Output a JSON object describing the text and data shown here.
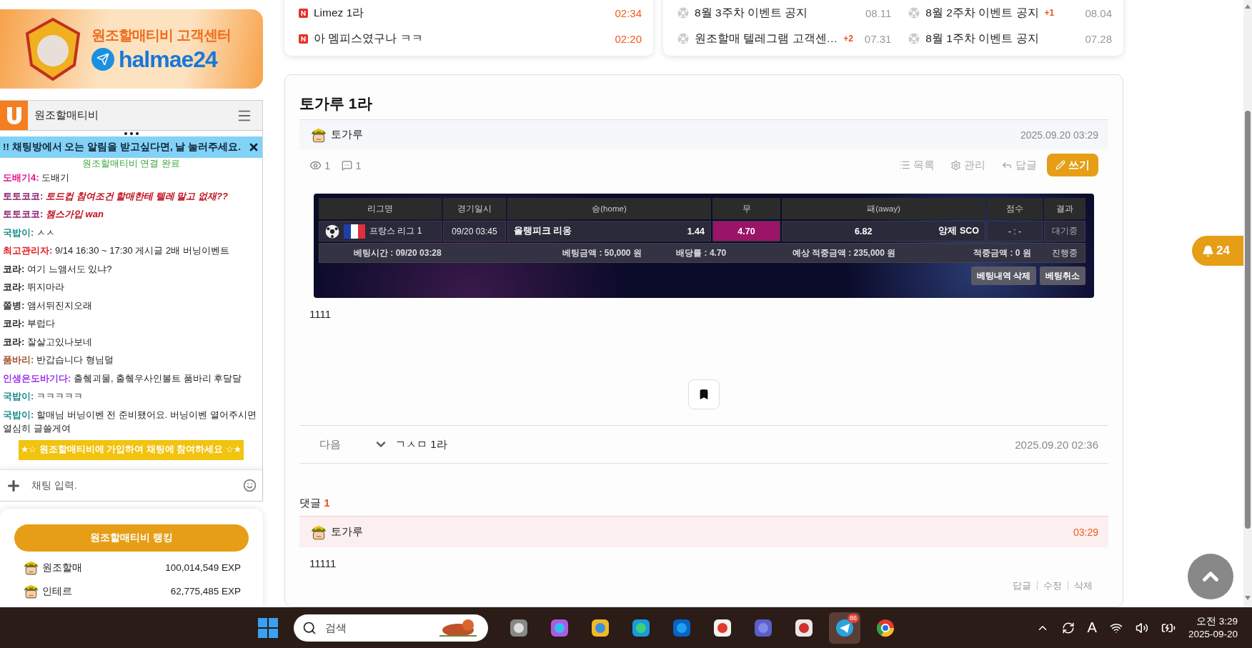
{
  "banner": {
    "title": "원조할매티비 고객센터",
    "handle": "halmae24"
  },
  "chat": {
    "title": "원조할매티비",
    "notice": "!! 채팅방에서 오는 알림을 받고싶다면, 날 눌러주세요.",
    "status": "원조할매티비 연결 완료",
    "messages": [
      {
        "user": "도배기4:",
        "color": "#e3128c",
        "text": "도배기",
        "emphasis": false
      },
      {
        "user": "토토코코:",
        "color": "#8a1d6e",
        "text": "토드컵 참여조건 할매한테 텔레 말고 없재??",
        "emphasis": true
      },
      {
        "user": "토토코코:",
        "color": "#8a1d6e",
        "text": "챔스가입 wan",
        "emphasis": true
      },
      {
        "user": "국밥이:",
        "color": "#178a8a",
        "text": "ㅅㅅ",
        "emphasis": false
      },
      {
        "user": "최고관리자:",
        "color": "#e01b1b",
        "text": "9/14 16:30 ~ 17:30 게시글 2배 버닝이벤트",
        "emphasis": false
      },
      {
        "user": "코라:",
        "color": "#222222",
        "text": "여기 느앰서도 있냐?",
        "emphasis": false
      },
      {
        "user": "코라:",
        "color": "#222222",
        "text": "뛰지마라",
        "emphasis": false
      },
      {
        "user": "쫄병:",
        "color": "#3a3a3a",
        "text": "앰서뒤진지오래",
        "emphasis": false
      },
      {
        "user": "코라:",
        "color": "#222222",
        "text": "부럽다",
        "emphasis": false
      },
      {
        "user": "코라:",
        "color": "#222222",
        "text": "잘살고있나보네",
        "emphasis": false
      },
      {
        "user": "품바리:",
        "color": "#a0522d",
        "text": "반갑습니다 형님덜",
        "emphasis": false
      },
      {
        "user": "인생은도바기다:",
        "color": "#9b2ff0",
        "text": "출췤괴물, 출췤우사인볼트 품바리 후달달",
        "emphasis": false
      },
      {
        "user": "국밥이:",
        "color": "#178a8a",
        "text": "ㅋㅋㅋㅋㅋ",
        "emphasis": false
      },
      {
        "user": "국밥이:",
        "color": "#178a8a",
        "text": "할매님 버닝이벤 전 준비됐어요. 버닝이벤 열어주시면 열심히 글쓸게여",
        "emphasis": false
      }
    ],
    "join_banner": "★☆ 원조할매티비에 가입하여 채팅에 참여하세요 ☆★",
    "input": {
      "placeholder": "채팅 입력."
    }
  },
  "ranking": {
    "button": "원조할매티비 랭킹",
    "rows": [
      {
        "name": "원조할매",
        "exp": "100,014,549 EXP"
      },
      {
        "name": "인테르",
        "exp": "62,775,485 EXP"
      }
    ]
  },
  "news": [
    {
      "title": "Limez 1라",
      "time": "02:34"
    },
    {
      "title": "아 멤피스였구나 ㅋㅋ",
      "time": "02:20"
    }
  ],
  "notices": [
    [
      {
        "title": "8월 3주차 이벤트 공지",
        "date": "08.11"
      },
      {
        "title": "원조할매 텔레그램 고객센…",
        "count": "+2",
        "date": "07.31"
      }
    ],
    [
      {
        "title": "8월 2주차 이벤트 공지",
        "count": "+1",
        "date": "08.04"
      },
      {
        "title": "8월 1주차 이벤트 공지",
        "date": "07.28"
      }
    ]
  ],
  "post": {
    "title": "토가루 1라",
    "author": "토가루",
    "date": "2025.09.20 03:29",
    "views": "1",
    "comments": "1",
    "actions": [
      {
        "kind": "list",
        "label": "목록"
      },
      {
        "kind": "manage",
        "label": "관리"
      },
      {
        "kind": "reply",
        "label": "답글"
      },
      {
        "kind": "write",
        "label": "쓰기"
      }
    ],
    "bet": {
      "columns": [
        "리그명",
        "경기일시",
        "승(home)",
        "무",
        "패(away)",
        "점수",
        "결과"
      ],
      "league": "프랑스 리그 1",
      "match_time": "09/20 03:45",
      "odds": [
        {
          "kind": "home",
          "team": "올랭피크 리옹",
          "value": "1.44",
          "selected": false
        },
        {
          "kind": "draw",
          "value": "4.70",
          "selected": true
        },
        {
          "kind": "away",
          "team": "앙제 SCO",
          "value": "6.82",
          "selected": false
        }
      ],
      "score": "- : -",
      "result": "대기중",
      "info": [
        "베팅시간 : 09/20 03:28",
        "베팅금액 : 50,000 원",
        "배당률 : 4.70",
        "예상 적중금액 : 235,000 원",
        "적중금액 : 0 원",
        "진행중"
      ],
      "buttons": [
        "베팅내역 삭제",
        "베팅취소"
      ]
    },
    "body": "1111",
    "next": {
      "label": "다음",
      "title": "ㄱㅅㅁ 1라",
      "date": "2025.09.20 02:36"
    },
    "comments_label": "댓글",
    "comments_count": "1",
    "comment": {
      "author": "토가루",
      "time": "03:29",
      "body": "11111",
      "actions": [
        "답글",
        "수정",
        "삭제"
      ]
    }
  },
  "notification_count": "24",
  "taskbar": {
    "search_placeholder": "검색",
    "telegram_badge": "86",
    "ime": "A",
    "time": "오전 3:29",
    "date": "2025-09-20"
  }
}
